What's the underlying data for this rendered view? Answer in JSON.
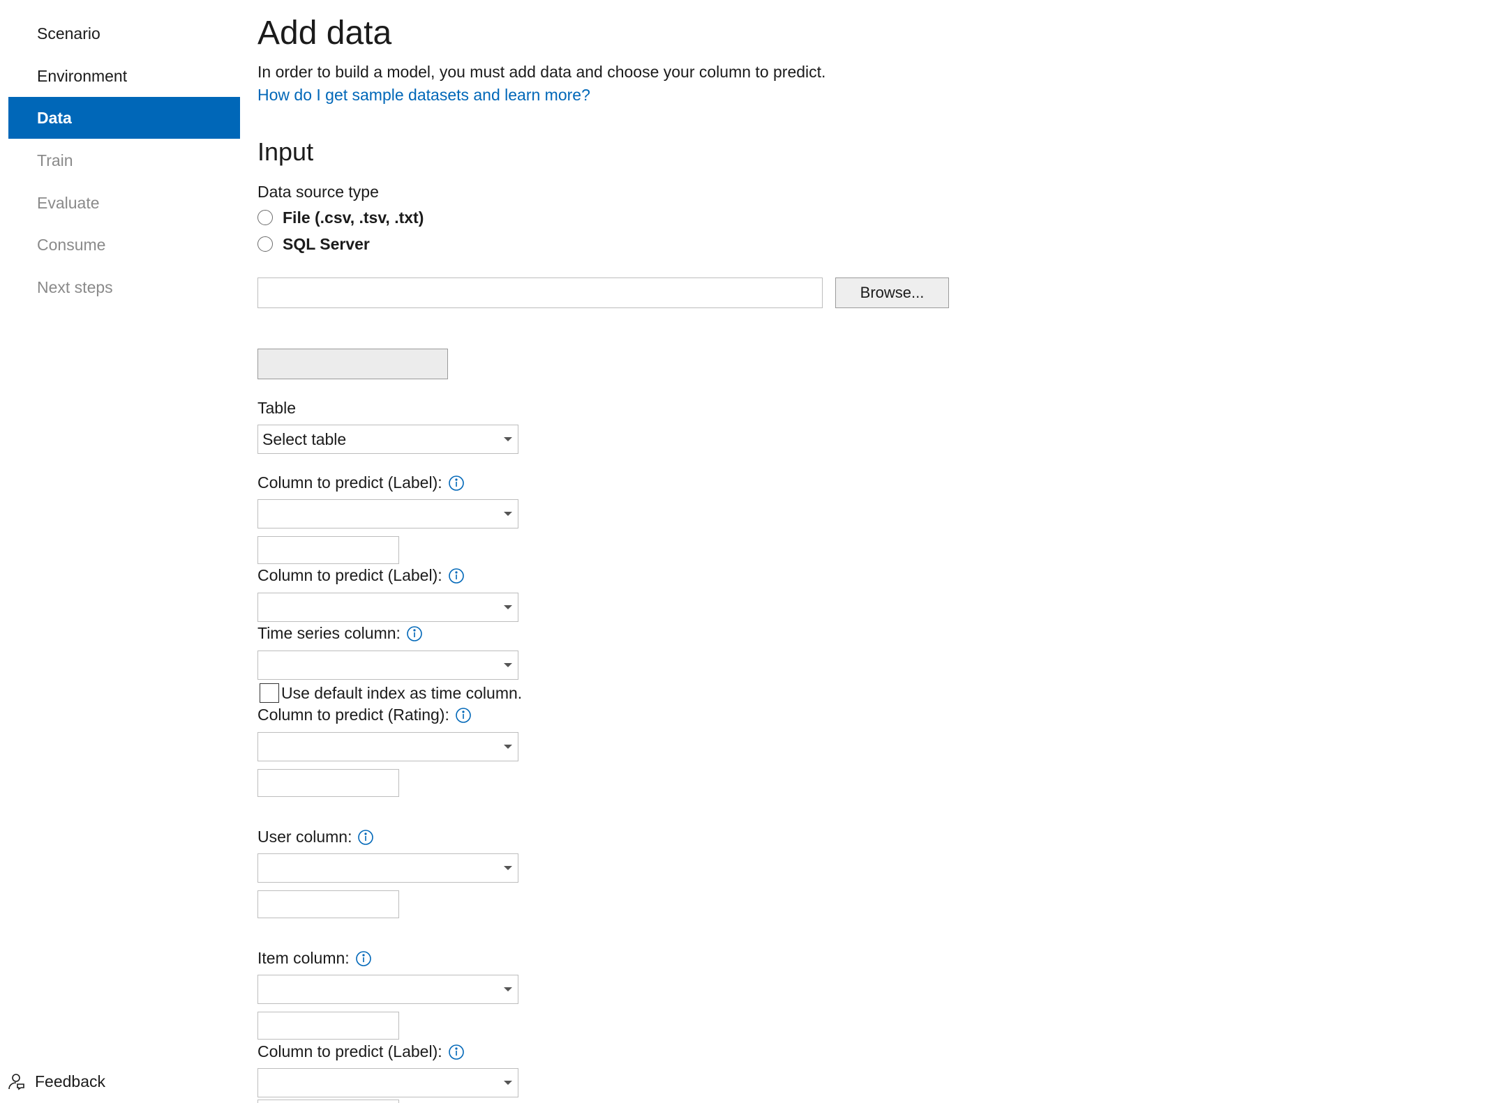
{
  "sidebar": {
    "items": [
      {
        "label": "Scenario"
      },
      {
        "label": "Environment"
      },
      {
        "label": "Data"
      },
      {
        "label": "Train"
      },
      {
        "label": "Evaluate"
      },
      {
        "label": "Consume"
      },
      {
        "label": "Next steps"
      }
    ],
    "feedback_label": "Feedback"
  },
  "main": {
    "title": "Add data",
    "intro": "In order to build a model, you must add data and choose your column to predict.",
    "help_link": "How do I get sample datasets and learn more?",
    "input_section_title": "Input",
    "data_source_label": "Data source type",
    "radio_file": "File (.csv, .tsv, .txt)",
    "radio_sql": "SQL Server",
    "file_path_value": "",
    "browse_label": "Browse...",
    "table_label": "Table",
    "table_select_value": "Select table",
    "label_column_predict": "Column to predict (Label):",
    "label_time_series": "Time series column:",
    "checkbox_default_index": "Use default index as time column.",
    "label_column_rating": "Column to predict (Rating):",
    "label_user_column": "User column:",
    "label_item_column": "Item column:"
  },
  "colors": {
    "accent": "#0067b8",
    "disabled_text": "#8a8a8a"
  }
}
